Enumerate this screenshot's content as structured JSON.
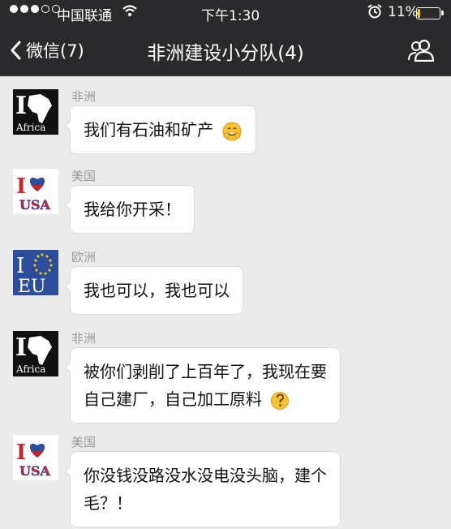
{
  "status_bar": {
    "carrier": "中国联通",
    "time": "下午1:30",
    "battery_percent": "11%",
    "battery_level": 0.11,
    "battery_color": "#f0c419",
    "signal_strength": 3,
    "icons": [
      "signal-dots-icon",
      "wifi-icon",
      "alarm-icon",
      "battery-icon"
    ]
  },
  "nav": {
    "back_label": "微信(7)",
    "title": "非洲建设小分队(4)",
    "icons": [
      "chevron-left-icon",
      "group-members-icon"
    ]
  },
  "messages": [
    {
      "sender": "非洲",
      "avatar": "I ❤ Africa",
      "avatar_icon": "africa-map-icon",
      "text_lines": [
        "我们有石油和矿产"
      ],
      "emoji": "smiling-emoji-icon"
    },
    {
      "sender": "美国",
      "avatar": "I ❤ USA",
      "avatar_icon": "usa-flag-heart-icon",
      "text_lines": [
        "我给你开采！"
      ]
    },
    {
      "sender": "欧洲",
      "avatar": "I ❤ EU",
      "avatar_icon": "eu-stars-icon",
      "text_lines": [
        "我也可以，我也可以"
      ]
    },
    {
      "sender": "非洲",
      "avatar": "I ❤ Africa",
      "avatar_icon": "africa-map-icon",
      "text_lines": [
        "被你们剥削了上百年了，我现在要",
        "自己建厂，自己加工原料"
      ],
      "emoji": "confused-emoji-icon"
    },
    {
      "sender": "美国",
      "avatar": "I ❤ USA",
      "avatar_icon": "usa-flag-heart-icon",
      "text_lines": [
        "你没钱没路没水没电没头脑，建个",
        "毛？！"
      ]
    }
  ],
  "colors": {
    "header_bg": "#2a2a2c",
    "chat_bg": "#ebebeb",
    "bubble_bg": "#ffffff",
    "sender_name": "#9a9a9a",
    "eu_blue": "#2c4d9c",
    "usa_red": "#c8242b"
  }
}
